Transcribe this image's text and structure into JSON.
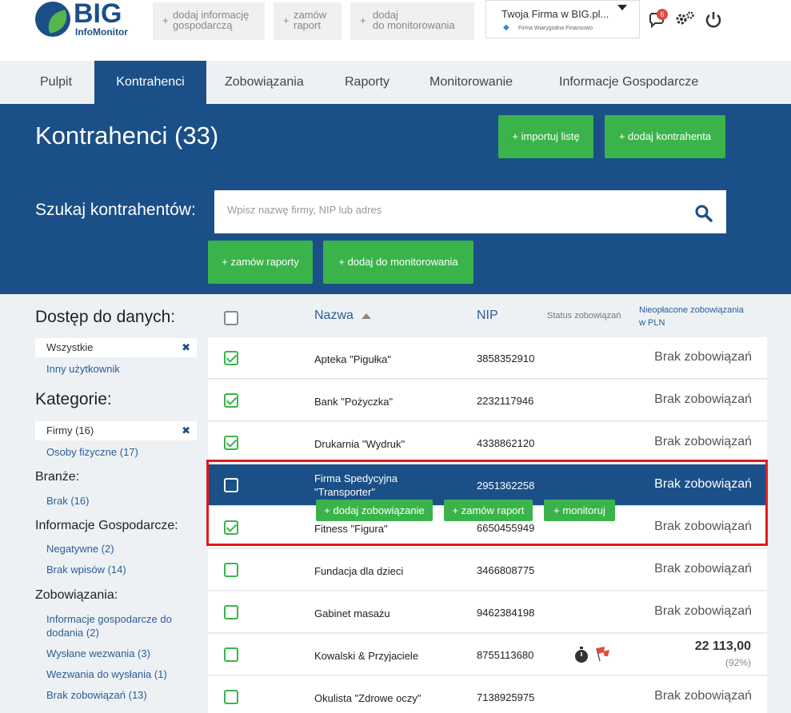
{
  "header": {
    "logo_main": "BIG",
    "logo_sub": "InfoMonitor",
    "top_buttons": [
      {
        "label": "dodaj informację\ngospodarczą"
      },
      {
        "label": "zamów\nraport"
      },
      {
        "label": "dodaj\ndo monitorowania"
      }
    ],
    "firm_name": "Twoja Firma w BIG.pl...",
    "firm_sub": "Firma Wiarygodna Finansowo",
    "notifications_count": "6"
  },
  "nav": {
    "items": [
      "Pulpit",
      "Kontrahenci",
      "Zobowiązania",
      "Raporty",
      "Monitorowanie",
      "Informacje Gospodarcze"
    ],
    "active": "Kontrahenci"
  },
  "hero": {
    "title": "Kontrahenci (33)",
    "import_btn": "+ importuj listę",
    "add_btn": "+ dodaj kontrahenta",
    "search_label": "Szukaj kontrahentów:",
    "search_placeholder": "Wpisz nazwę firmy, NIP lub adres",
    "order_reports_btn": "+ zamów raporty",
    "add_monitor_btn": "+ dodaj do monitorowania"
  },
  "sidebar": {
    "access_title": "Dostęp do danych:",
    "access_selected": "Wszystkie",
    "access_other": "Inny użytkownik",
    "categories_title": "Kategorie:",
    "category_selected": "Firmy (16)",
    "category_other": "Osoby fizyczne (17)",
    "industries_title": "Branże:",
    "industries": [
      "Brak (16)"
    ],
    "info_title": "Informacje Gospodarcze:",
    "info_items": [
      "Negatywne (2)",
      "Brak wpisów (14)"
    ],
    "obligations_title": "Zobowiązania:",
    "obligations_items": [
      "Informacje gospodarcze do\ndodania (2)",
      "Wysłane wezwania (3)",
      "Wezwania do wysłania (1)",
      "Brak zobowiązań (13)"
    ]
  },
  "table": {
    "col_name": "Nazwa",
    "col_nip": "NIP",
    "col_status": "Status zobowiązań",
    "col_unpaid": "Nieopłacone zobowiązania\nw PLN",
    "rows": [
      {
        "name": "Apteka \"Pigułka\"",
        "nip": "3858352910",
        "owed": "Brak zobowiązań",
        "checked": true
      },
      {
        "name": "Bank \"Pożyczka\"",
        "nip": "2232117946",
        "owed": "Brak zobowiązań",
        "checked": true
      },
      {
        "name": "Drukarnia \"Wydruk\"",
        "nip": "4338862120",
        "owed": "Brak zobowiązań",
        "checked": true
      },
      {
        "name": "Firma Spedycyjna\n\"Transporter\"",
        "nip": "2951362258",
        "owed": "Brak zobowiązań",
        "checked": false,
        "selected": true
      },
      {
        "name": "Fitness \"Figura\"",
        "nip": "6650455949",
        "owed": "Brak zobowiązań",
        "checked": true
      },
      {
        "name": "Fundacja dla dzieci",
        "nip": "3466808775",
        "owed": "Brak zobowiązań",
        "checked": false
      },
      {
        "name": "Gabinet masażu",
        "nip": "9462384198",
        "owed": "Brak zobowiązań",
        "checked": false
      },
      {
        "name": "Kowalski & Przyjaciele",
        "nip": "8755113680",
        "amount": "22 113,00",
        "pct": "(92%)",
        "checked": false
      },
      {
        "name": "Okulista \"Zdrowe oczy\"",
        "nip": "7138925975",
        "owed": "Brak zobowiązań",
        "checked": false
      }
    ],
    "row_actions": {
      "add_obligation": "+ dodaj zobowiązanie",
      "order_report": "+ zamów raport",
      "monitor": "+ monitoruj"
    }
  },
  "colors": {
    "brand_blue": "#1b4f88",
    "green": "#3ab44a",
    "highlight_red": "#e21b1b"
  }
}
